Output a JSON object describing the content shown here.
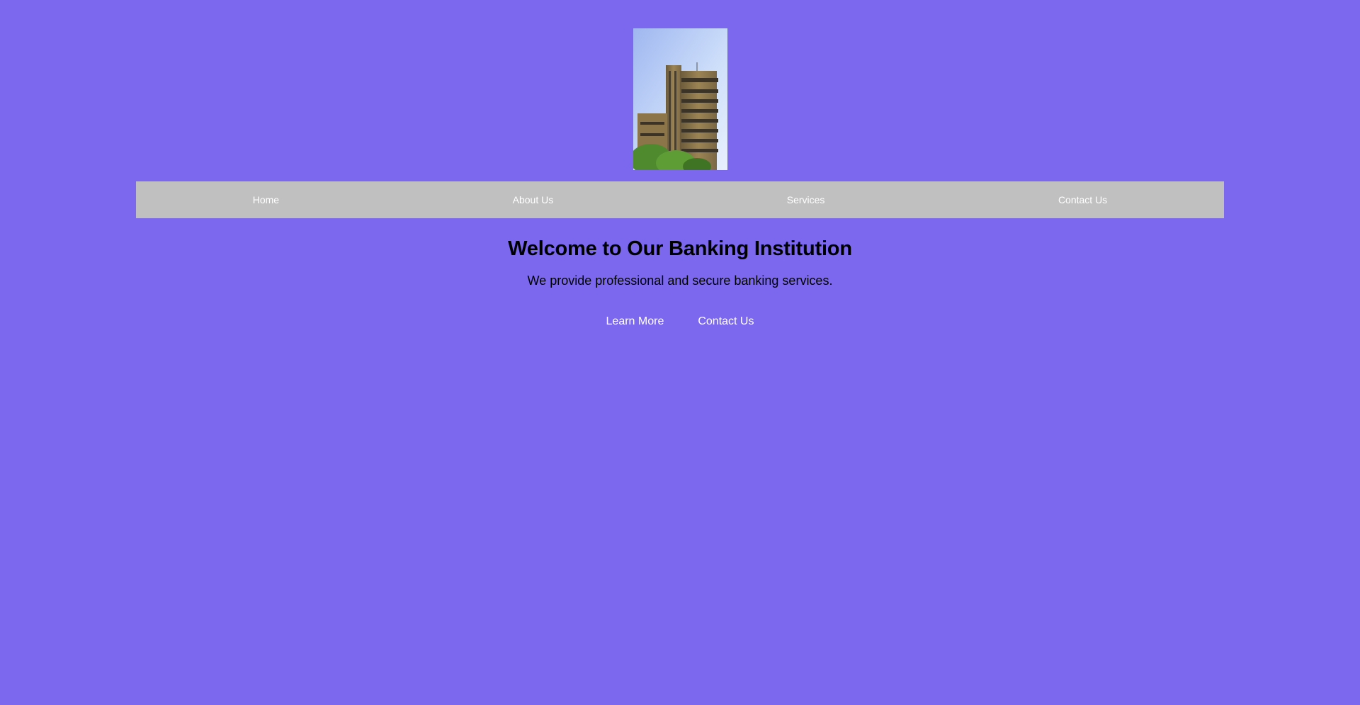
{
  "header": {
    "logo_image": "building-photo"
  },
  "nav": {
    "items": [
      {
        "label": "Home"
      },
      {
        "label": "About Us"
      },
      {
        "label": "Services"
      },
      {
        "label": "Contact Us"
      }
    ]
  },
  "welcome": {
    "title": "Welcome to Our Banking Institution",
    "subtitle": "We provide professional and secure banking services.",
    "buttons": {
      "learn_more": "Learn More",
      "contact_us": "Contact Us"
    }
  },
  "colors": {
    "background": "#7b68ee",
    "nav_background": "#c0c0c0",
    "nav_text": "#ffffff",
    "heading_text": "#000000",
    "button_text": "#ffffff"
  }
}
